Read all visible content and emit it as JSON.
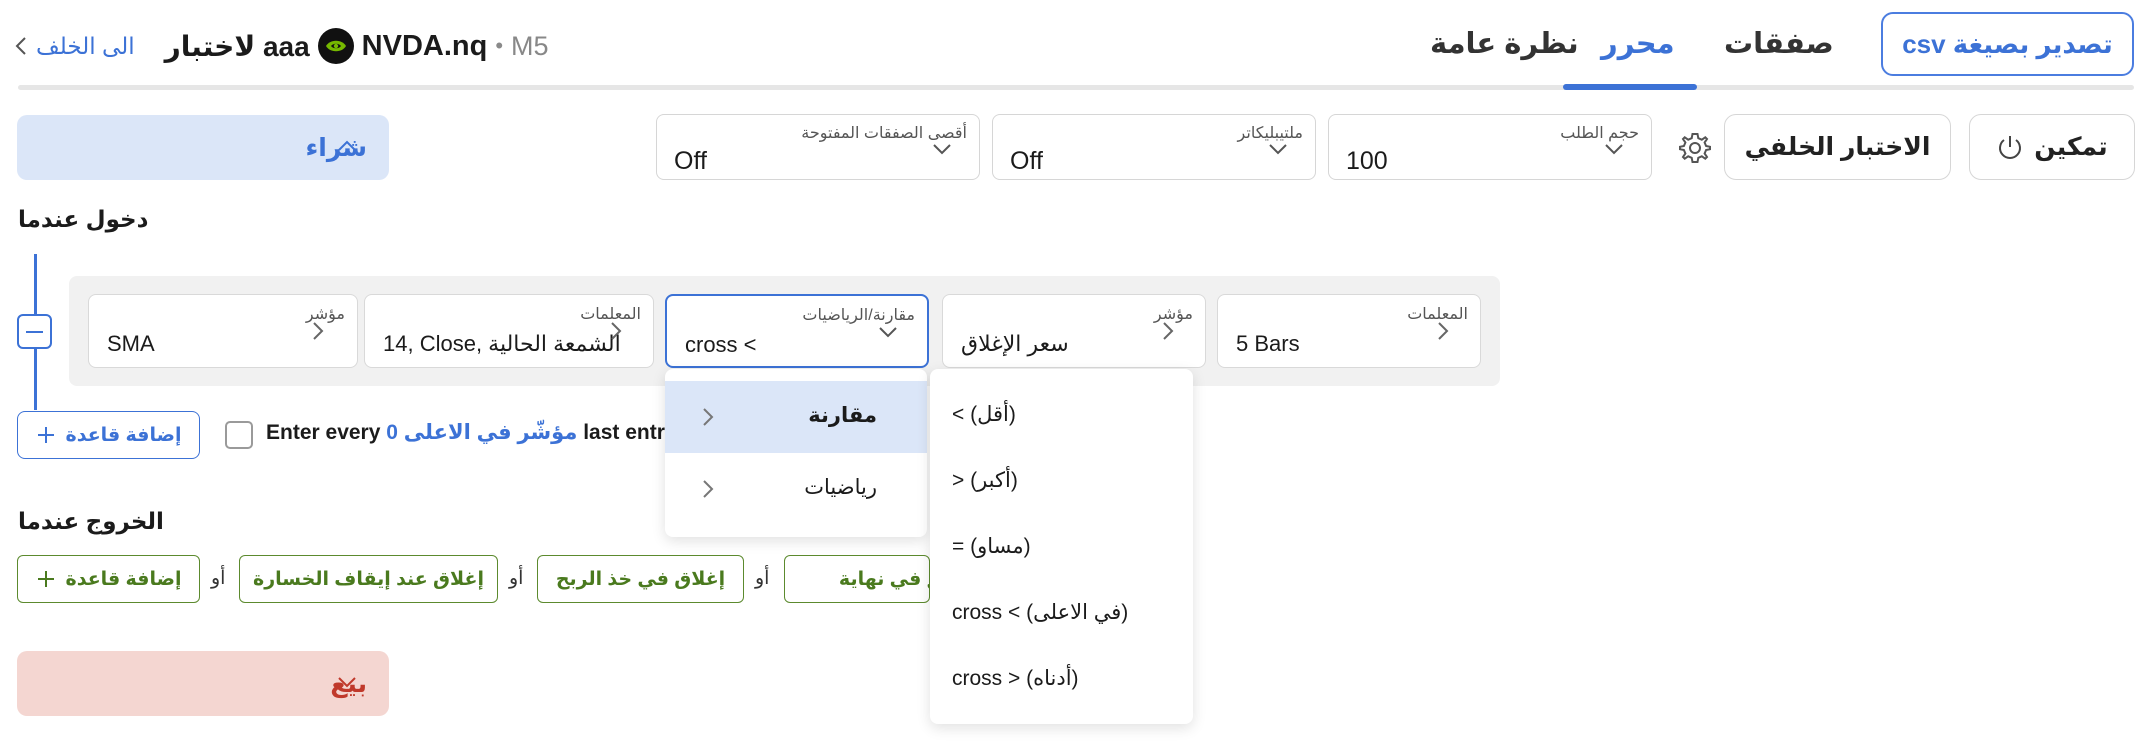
{
  "header": {
    "back_label": "الى الخلف",
    "test_title": "لاختبار aaa",
    "symbol": "NVDA.nq",
    "separator": "•",
    "timeframe": "M5"
  },
  "tabs": [
    {
      "label": "نظرة عامة",
      "active": false
    },
    {
      "label": "محرر",
      "active": true
    },
    {
      "label": "صفقات",
      "active": false
    }
  ],
  "export_button": "csv تصدير بصيغة",
  "toolbar": {
    "buy_label": "شراء",
    "max_open_trades": {
      "label": "أقصى الصفقات المفتوحة",
      "value": "Off"
    },
    "multiplicator": {
      "label": "ملتيبليكاتر",
      "value": "Off"
    },
    "order_size": {
      "label": "حجم الطلب",
      "value": "100"
    },
    "backtest_button": "الاختبار الخلفي",
    "enable_button": "تمكين"
  },
  "entry": {
    "title": "دخول عندما",
    "cards": [
      {
        "label": "مؤشر",
        "value": "SMA"
      },
      {
        "label": "المعلمات",
        "value": "14, Close, الشمعة الحالية"
      },
      {
        "label": "مقارنة/الرياضيات",
        "value": "cross <"
      },
      {
        "label": "مؤشر",
        "value": "سعر الإغلاق"
      },
      {
        "label": "المعلمات",
        "value": "5 Bars"
      }
    ],
    "add_rule": "إضافة قاعدة",
    "enter_every": {
      "prefix": "Enter every",
      "count": "0",
      "link": "مؤشّر في الاعلى",
      "suffix": "last entry"
    }
  },
  "exit": {
    "title": "الخروج عندما",
    "add_rule": "إضافة قاعدة",
    "or": "أو",
    "buttons": [
      "إغلاق عند إيقاف الخسارة",
      "إغلاق في خذ الربح",
      "اغلق في نهاية"
    ]
  },
  "sell_label": "بيع",
  "menu": {
    "categories": [
      {
        "label": "مقارنة",
        "selected": true
      },
      {
        "label": "رياضيات",
        "selected": false
      }
    ],
    "options": [
      "< (أقل)",
      "> (أكبر)",
      "= (مساو)",
      "cross < (في الاعلى)",
      "cross > (أدناه)"
    ]
  },
  "colors": {
    "accent": "#3c72d6",
    "buy_bg": "#dbe6f8",
    "sell_bg": "#f4d6d1",
    "sell_text": "#c0392b",
    "exit_green": "#4a7a1e"
  },
  "icons": [
    "chevron-left-icon",
    "nvidia-logo-icon",
    "chevron-up-icon",
    "chevron-down-icon",
    "gear-icon",
    "power-icon",
    "chevron-right-icon",
    "plus-icon",
    "minus-icon"
  ]
}
